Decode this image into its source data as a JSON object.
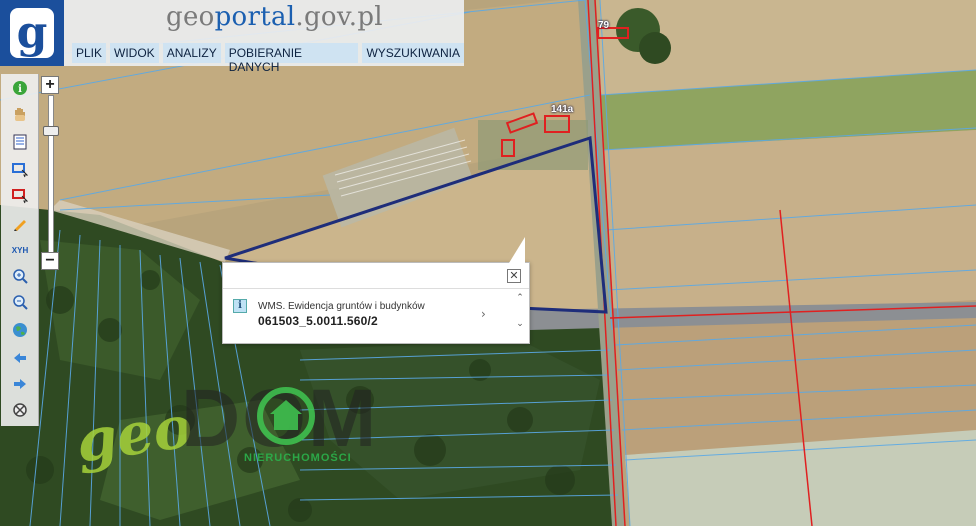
{
  "header": {
    "logo_letter": "g",
    "title_part1": "geo",
    "title_part2": "portal",
    "title_part3": ".gov.pl"
  },
  "menu": {
    "items": [
      "PLIK",
      "WIDOK",
      "ANALIZY",
      "POBIERANIE DANYCH",
      "WYSZUKIWANIA"
    ]
  },
  "toolbar": {
    "tools": [
      "info-icon",
      "pan-hand-icon",
      "layers-list-icon",
      "select-area-icon",
      "select-object-icon",
      "edit-pencil-icon",
      "xyh-coordinates-icon",
      "zoom-in-icon",
      "zoom-out-icon",
      "globe-icon",
      "back-arrow-icon",
      "forward-arrow-icon",
      "clear-icon"
    ],
    "xyh_label": "XYH"
  },
  "zoom": {
    "plus": "+",
    "minus": "−"
  },
  "popup": {
    "info_glyph": "i",
    "layer": "WMS. Ewidencja gruntów i budynków",
    "parcel_id": "061503_5.0011.560/2",
    "close_glyph": "✕",
    "next_glyph": "›",
    "scroll_up": "⌃",
    "scroll_down": "⌄"
  },
  "map_labels": {
    "parcel_79": "79",
    "parcel_141a": "141a"
  },
  "watermark": {
    "part1": "geo",
    "part2": "DOM",
    "sub": "NIERUCHOMOŚCI"
  },
  "colors": {
    "parcel_boundary": "#1e2d7a",
    "cadastre_lines": "#5aa9e6",
    "road_lines": "#e02020",
    "menu_bg": "#cfe3f2",
    "logo_bg": "#1b4f9c"
  }
}
